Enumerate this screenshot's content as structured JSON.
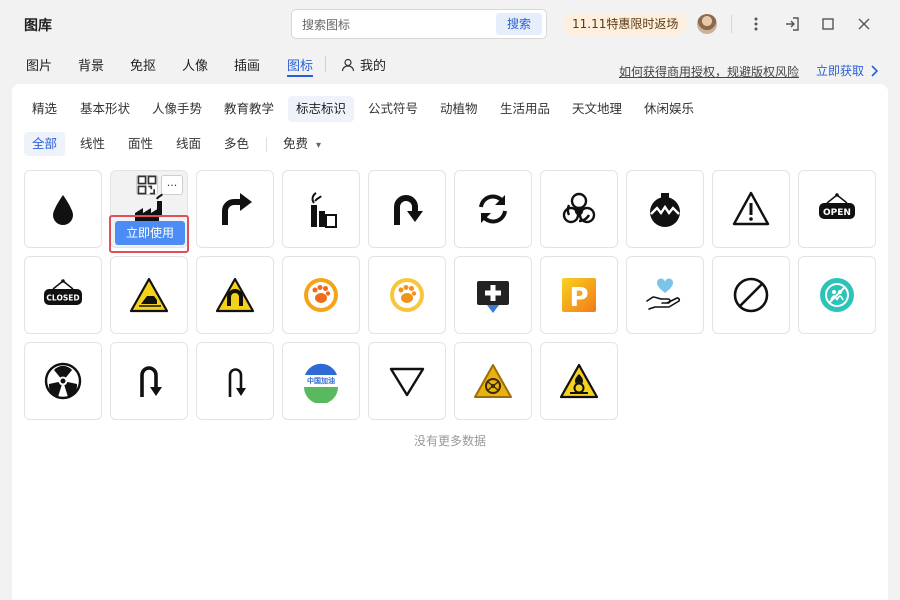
{
  "app": {
    "title": "图库"
  },
  "search": {
    "placeholder": "搜索图标",
    "button_label": "搜索"
  },
  "promo": {
    "label": "11.11特惠限时返场"
  },
  "tabs": [
    {
      "label": "图片"
    },
    {
      "label": "背景"
    },
    {
      "label": "免抠"
    },
    {
      "label": "人像"
    },
    {
      "label": "插画"
    },
    {
      "label": "图标",
      "active": true
    }
  ],
  "mine": {
    "label": "我的"
  },
  "license": {
    "link_text": "如何获得商用授权，规避版权风险",
    "get_label": "立即获取"
  },
  "categories": [
    {
      "label": "精选"
    },
    {
      "label": "基本形状"
    },
    {
      "label": "人像手势"
    },
    {
      "label": "教育教学"
    },
    {
      "label": "标志标识",
      "active": true
    },
    {
      "label": "公式符号"
    },
    {
      "label": "动植物"
    },
    {
      "label": "生活用品"
    },
    {
      "label": "天文地理"
    },
    {
      "label": "休闲娱乐"
    }
  ],
  "filters": [
    {
      "label": "全部",
      "active": true
    },
    {
      "label": "线性"
    },
    {
      "label": "面性"
    },
    {
      "label": "线面"
    },
    {
      "label": "多色"
    }
  ],
  "price_filter": {
    "label": "免费",
    "caret": "▾"
  },
  "hover_card": {
    "use_label": "立即使用",
    "more_label": "···"
  },
  "icons": [
    {
      "name": "water-drop-icon"
    },
    {
      "name": "factory-icon"
    },
    {
      "name": "turn-right-arrow-icon"
    },
    {
      "name": "industry-plant-icon"
    },
    {
      "name": "u-turn-arrow-icon"
    },
    {
      "name": "refresh-icon"
    },
    {
      "name": "biohazard-icon"
    },
    {
      "name": "pollution-bomb-icon"
    },
    {
      "name": "warning-triangle-icon"
    },
    {
      "name": "open-sign-icon",
      "text": "OPEN"
    },
    {
      "name": "closed-sign-icon",
      "text": "CLOSED"
    },
    {
      "name": "falling-car-warning-icon"
    },
    {
      "name": "magnet-warning-icon"
    },
    {
      "name": "paw-orange-icon"
    },
    {
      "name": "paw-yellow-icon"
    },
    {
      "name": "medical-cross-icon"
    },
    {
      "name": "parking-sign-icon",
      "text": "P"
    },
    {
      "name": "heart-hand-icon"
    },
    {
      "name": "prohibited-icon"
    },
    {
      "name": "no-people-icon"
    },
    {
      "name": "radiation-icon"
    },
    {
      "name": "u-turn-down-icon"
    },
    {
      "name": "u-turn-down-thin-icon"
    },
    {
      "name": "china-badge-icon",
      "text": "中国加油"
    },
    {
      "name": "triangle-down-icon"
    },
    {
      "name": "biohazard-warning-icon"
    },
    {
      "name": "oxidizer-warning-icon"
    }
  ],
  "status": {
    "no_more": "没有更多数据"
  }
}
